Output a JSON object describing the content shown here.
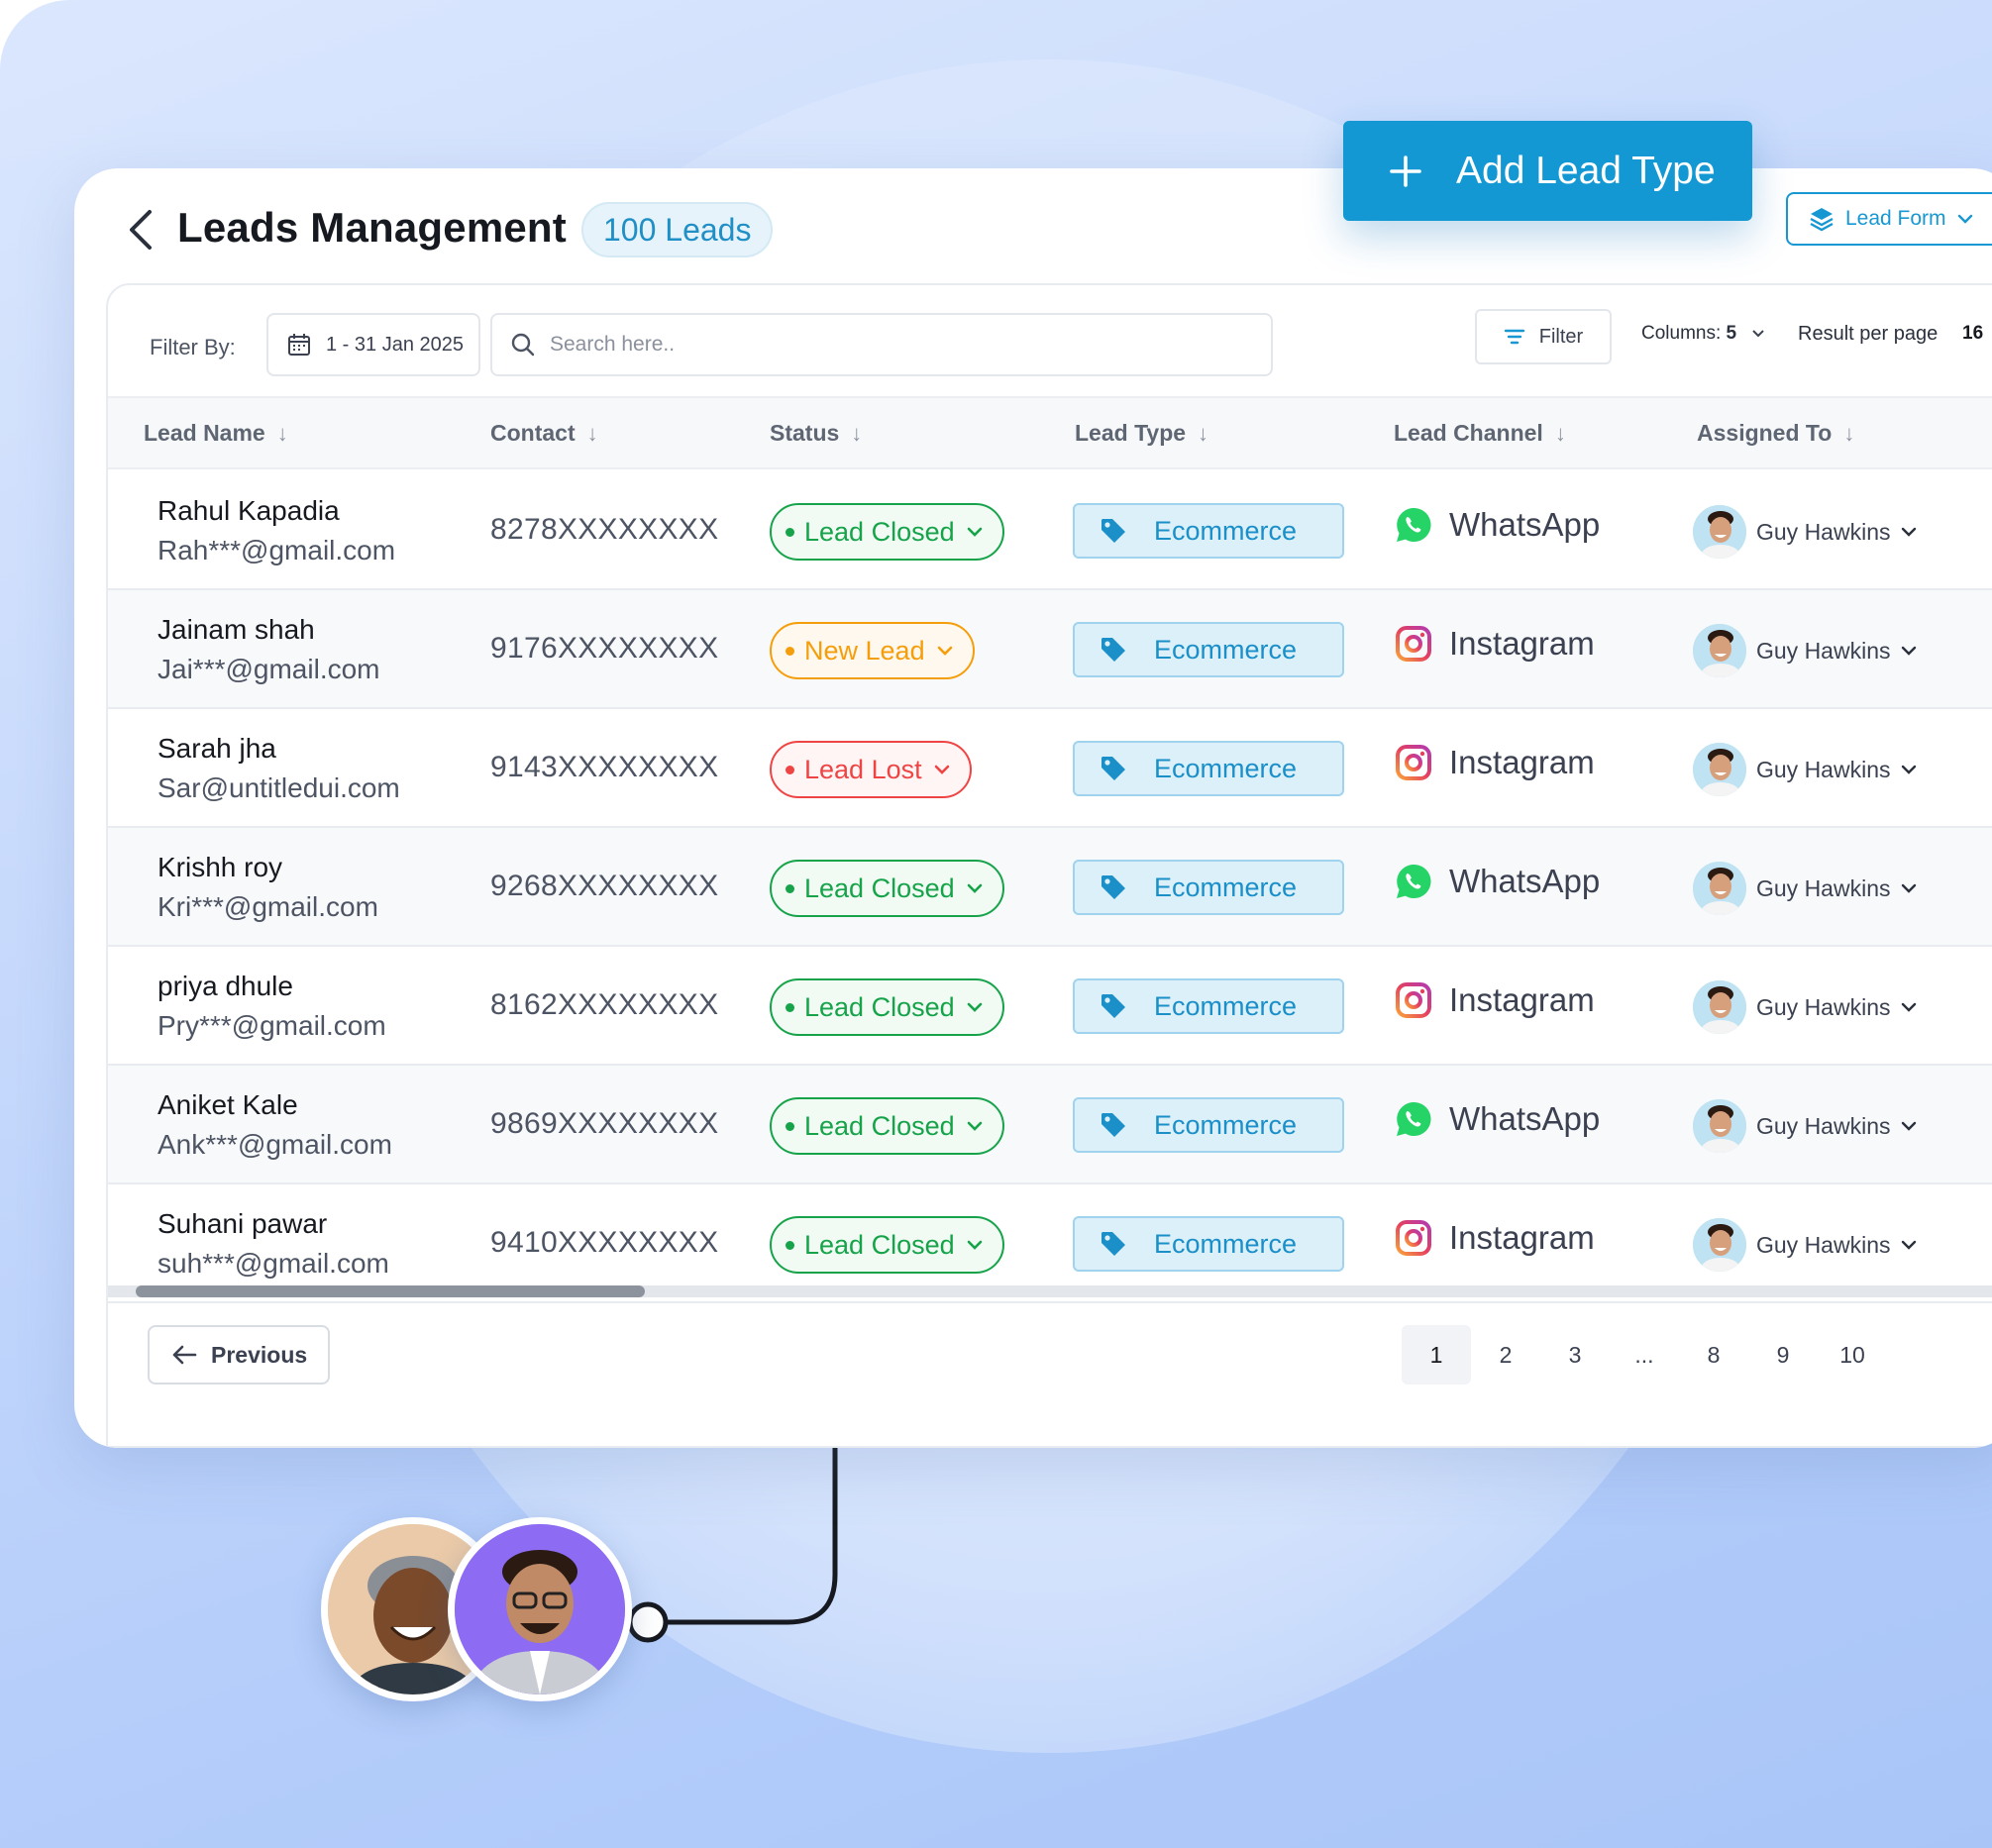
{
  "header": {
    "title": "Leads Management",
    "count_badge": "100 Leads",
    "add_button": "Add Lead Type",
    "lead_form_button": "Lead Form"
  },
  "toolbar": {
    "filter_by_label": "Filter By:",
    "date_range": "1 - 31 Jan 2025",
    "search_placeholder": "Search here..",
    "filter_button": "Filter",
    "columns_label": "Columns:",
    "columns_value": "5",
    "result_per_page_label": "Result per page",
    "result_per_page_value": "16"
  },
  "table": {
    "columns": [
      "Lead Name",
      "Contact",
      "Status",
      "Lead Type",
      "Lead Channel",
      "Assigned To"
    ],
    "rows": [
      {
        "name": "Rahul Kapadia",
        "email": "Rah***@gmail.com",
        "contact": "8278XXXXXXXX",
        "status": "Lead Closed",
        "status_kind": "closed",
        "lead_type": "Ecommerce",
        "channel": "WhatsApp",
        "assigned": "Guy Hawkins"
      },
      {
        "name": "Jainam shah",
        "email": "Jai***@gmail.com",
        "contact": "9176XXXXXXXX",
        "status": "New Lead",
        "status_kind": "new",
        "lead_type": "Ecommerce",
        "channel": "Instagram",
        "assigned": "Guy Hawkins"
      },
      {
        "name": "Sarah jha",
        "email": "Sar@untitledui.com",
        "contact": "9143XXXXXXXX",
        "status": "Lead Lost",
        "status_kind": "lost",
        "lead_type": "Ecommerce",
        "channel": "Instagram",
        "assigned": "Guy Hawkins"
      },
      {
        "name": "Krishh roy",
        "email": "Kri***@gmail.com",
        "contact": "9268XXXXXXXX",
        "status": "Lead Closed",
        "status_kind": "closed",
        "lead_type": "Ecommerce",
        "channel": "WhatsApp",
        "assigned": "Guy Hawkins"
      },
      {
        "name": "priya dhule",
        "email": "Pry***@gmail.com",
        "contact": "8162XXXXXXXX",
        "status": "Lead Closed",
        "status_kind": "closed",
        "lead_type": "Ecommerce",
        "channel": "Instagram",
        "assigned": "Guy Hawkins"
      },
      {
        "name": "Aniket Kale",
        "email": "Ank***@gmail.com",
        "contact": "9869XXXXXXXX",
        "status": "Lead Closed",
        "status_kind": "closed",
        "lead_type": "Ecommerce",
        "channel": "WhatsApp",
        "assigned": "Guy Hawkins"
      },
      {
        "name": "Suhani pawar",
        "email": "suh***@gmail.com",
        "contact": "9410XXXXXXXX",
        "status": "Lead Closed",
        "status_kind": "closed",
        "lead_type": "Ecommerce",
        "channel": "Instagram",
        "assigned": "Guy Hawkins"
      }
    ]
  },
  "pagination": {
    "previous_label": "Previous",
    "pages": [
      "1",
      "2",
      "3",
      "...",
      "8",
      "9",
      "10"
    ],
    "current": "1"
  },
  "colors": {
    "accent": "#1498d4",
    "closed": "#16a34a",
    "new": "#f59e0b",
    "lost": "#ef4444",
    "whatsapp": "#25d366",
    "instagram": "#e4405f"
  },
  "icons": {
    "back": "chevron-left-icon",
    "add": "plus-icon",
    "lead_form": "layers-icon",
    "date": "calendar-icon",
    "search": "search-icon",
    "filter": "filter-lines-icon",
    "lead_type": "tag-icon",
    "whatsapp": "whatsapp-icon",
    "instagram": "instagram-icon"
  }
}
